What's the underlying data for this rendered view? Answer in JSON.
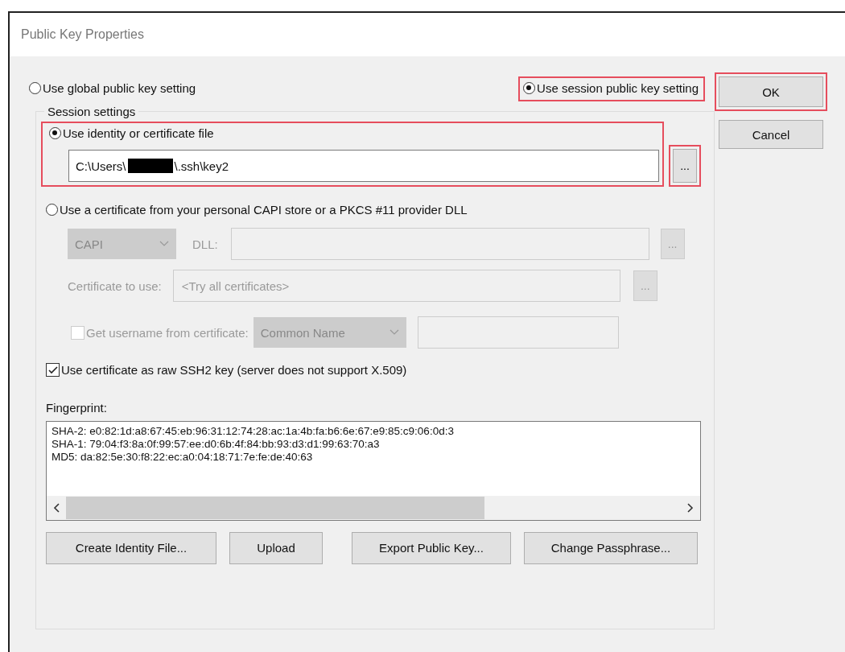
{
  "window": {
    "title": "Public Key Properties"
  },
  "mode_options": [
    {
      "label": "Use global public key setting",
      "selected": false,
      "highlighted": false
    },
    {
      "label": "Use session public key setting",
      "selected": true,
      "highlighted": true
    }
  ],
  "buttons": [
    {
      "label": "OK",
      "highlighted": true
    },
    {
      "label": "Cancel",
      "highlighted": false
    }
  ],
  "session_settings": {
    "title": "Session settings",
    "identity": {
      "option": {
        "label": "Use identity or certificate file",
        "selected": true
      },
      "highlighted": true,
      "value_start": "C:\\Users\\",
      "redacted": true,
      "value_end": "\\.ssh\\key2",
      "browse": {
        "label": "...",
        "highlighted": true
      }
    },
    "provider": {
      "option": {
        "label": "Use a certificate from your personal CAPI store or a PKCS #11 provider DLL",
        "selected": false
      },
      "disabled": true,
      "type_select": "CAPI",
      "dll_label": "DLL:",
      "dll_browse": "...",
      "certificate_label": "Certificate to use:",
      "certificate_value": "<Try all certificates>",
      "certificate_browse": "...",
      "username": {
        "label": "Get username from certificate:",
        "checked": false
      },
      "username_select": "Common Name"
    },
    "raw_key": {
      "label": "Use certificate as raw SSH2 key (server does not support X.509)",
      "checked": true
    },
    "fingerprint": {
      "label": "Fingerprint:",
      "lines": [
        "SHA-2: e0:82:1d:a8:67:45:eb:96:31:12:74:28:ac:1a:4b:fa:b6:6e:67:e9:85:c9:06:0d:3",
        "SHA-1: 79:04:f3:8a:0f:99:57:ee:d0:6b:4f:84:bb:93:d3:d1:99:63:70:a3",
        "MD5: da:82:5e:30:f8:22:ec:a0:04:18:71:7e:fe:de:40:63"
      ]
    },
    "actions": [
      "Create Identity File...",
      "Upload",
      "Export Public Key...",
      "Change Passphrase..."
    ]
  }
}
